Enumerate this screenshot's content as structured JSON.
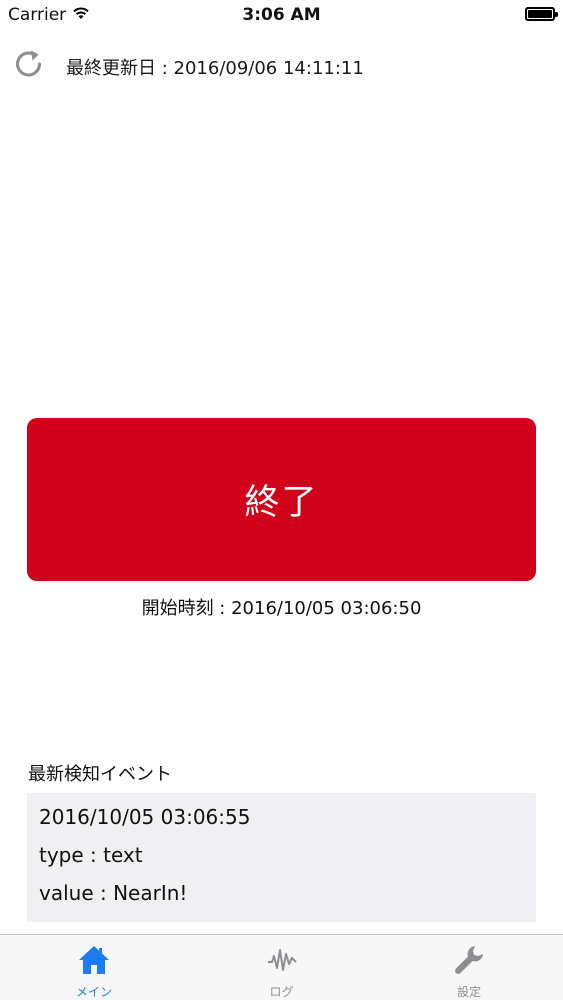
{
  "status_bar": {
    "carrier": "Carrier",
    "time": "3:06 AM",
    "battery_level": 1.0
  },
  "header": {
    "refresh_icon": "refresh-icon",
    "last_updated": "最終更新日 : 2016/09/06 14:11:11"
  },
  "main": {
    "stop_button_label": "終了",
    "stop_button_color": "#d0021b",
    "start_time": "開始時刻 : 2016/10/05 03:06:50"
  },
  "latest_event": {
    "heading": "最新検知イベント",
    "lines": [
      "2016/10/05 03:06:55",
      "type : text",
      "value : NearIn!"
    ]
  },
  "tab_bar": {
    "active_color": "#1e7cf2",
    "inactive_color": "#8e8e93",
    "tabs": [
      {
        "label": "メイン",
        "icon": "home-icon",
        "active": true
      },
      {
        "label": "ログ",
        "icon": "waveform-icon",
        "active": false
      },
      {
        "label": "設定",
        "icon": "wrench-icon",
        "active": false
      }
    ]
  }
}
